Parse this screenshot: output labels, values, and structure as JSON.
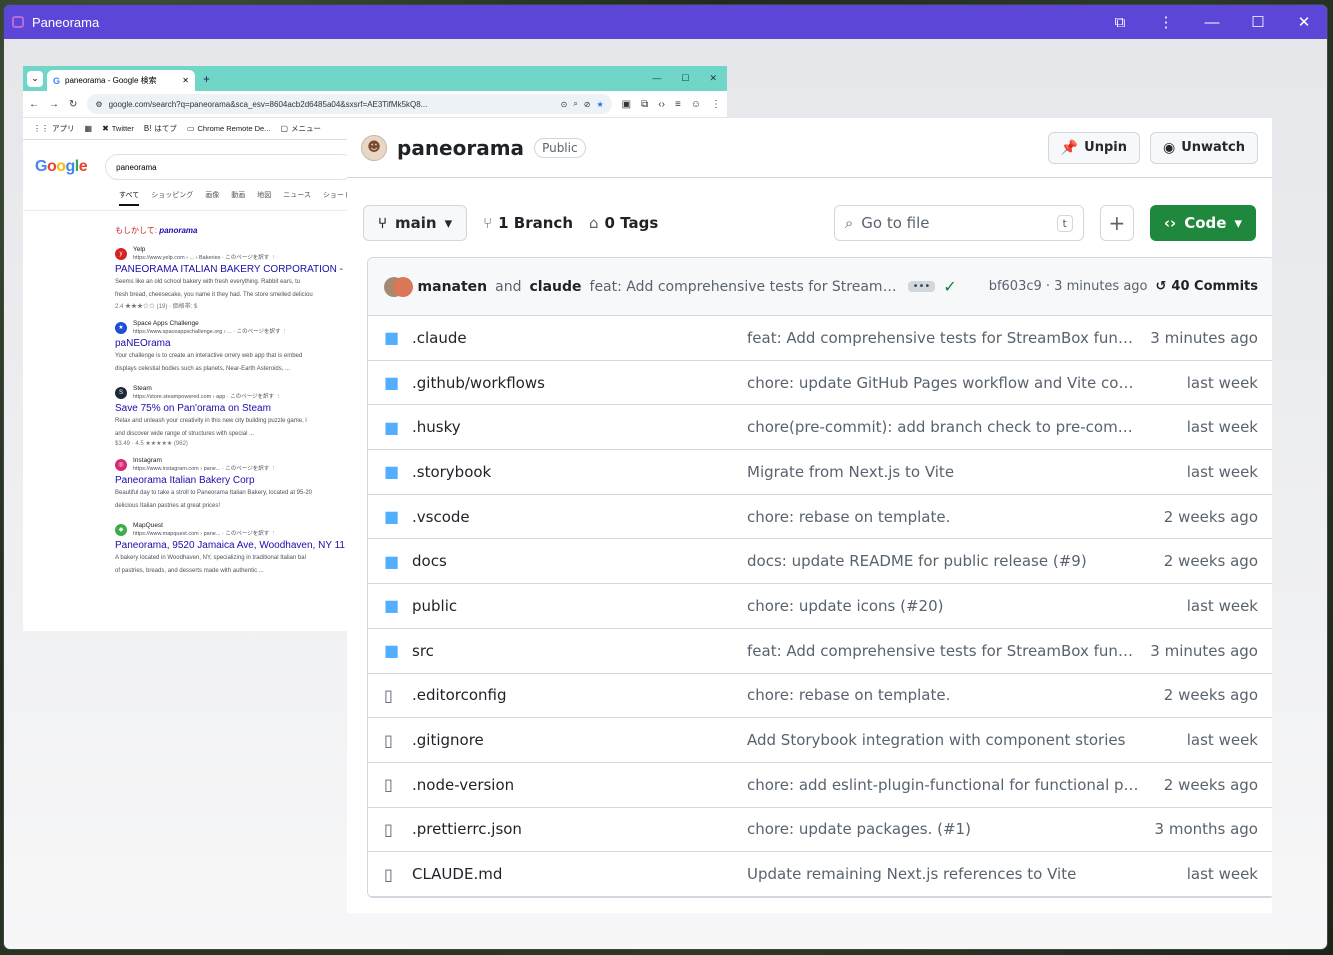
{
  "window": {
    "title": "Paneorama"
  },
  "chrome": {
    "tab_title": "paneorama - Google 検索",
    "url": "google.com/search?q=paneorama&sca_esv=8604acb2d6485a04&sxsrf=AE3TifMk5kQ8...",
    "bookmarks": [
      "アプリ",
      "Twitter",
      "はてブ",
      "Chrome Remote De...",
      "メニュー"
    ],
    "logo": "Google",
    "query": "paneorama",
    "tabs": [
      "すべて",
      "ショッピング",
      "画像",
      "動画",
      "地図",
      "ニュース",
      "ショート"
    ],
    "suggest_prefix": "もしかして:",
    "suggest_term": "panorama",
    "results": [
      {
        "source": "Yelp",
        "url": "https://www.yelp.com › ... › Bakeries · このページを訳す ⋮",
        "title": "PANEORAMA ITALIAN BAKERY CORPORATION -",
        "snippet1": "Seems like an old school bakery with fresh everything. Rabbit ears, tu",
        "snippet2": "fresh bread, cheesecake, you name it they had. The store smelled deliciou",
        "meta": "2.4 ★★★☆☆ (19) · 価格帯: $",
        "color": "#d32323",
        "glyph": "y"
      },
      {
        "source": "Space Apps Challenge",
        "url": "https://www.spaceappschallenge.org › ... · このページを訳す ⋮",
        "title": "paNEOrama",
        "snippet1": "Your challenge is to create an interactive orrery web app that is embed",
        "snippet2": "displays celestial bodies such as planets, Near-Earth Asteroids, ...",
        "meta": "",
        "color": "#1d4ed8",
        "glyph": "★"
      },
      {
        "source": "Steam",
        "url": "https://store.steampowered.com › app · このページを訳す ⋮",
        "title": "Save 75% on Pan'orama on Steam",
        "snippet1": "Relax and unleash your creativity in this new city building puzzle game, l",
        "snippet2": "and discover wide range of structures with special ...",
        "meta": "$3.49 · 4.5 ★★★★★ (962)",
        "color": "#1b2838",
        "glyph": "S"
      },
      {
        "source": "Instagram",
        "url": "https://www.instagram.com › pane... · このページを訳す ⋮",
        "title": "Paneorama Italian Bakery Corp",
        "snippet1": "Beautiful day to take a stroll to Paneorama Italian Bakery, located at 95-20",
        "snippet2": "delicious Italian pastries at great prices!",
        "meta": "",
        "color": "#d62976",
        "glyph": "◎"
      },
      {
        "source": "MapQuest",
        "url": "https://www.mapquest.com › pane... · このページを訳す ⋮",
        "title": "Paneorama, 9520 Jamaica Ave, Woodhaven, NY 11",
        "snippet1": "A bakery located in Woodhaven, NY, specializing in traditional Italian bal",
        "snippet2": "of pastries, breads, and desserts made with authentic ...",
        "meta": "",
        "color": "#3bae4a",
        "glyph": "◆"
      }
    ]
  },
  "github": {
    "repo": "paneorama",
    "visibility": "Public",
    "unpin": "Unpin",
    "unwatch": "Unwatch",
    "branch": "main",
    "branches": "1 Branch",
    "tags": "0 Tags",
    "goto": "Go to file",
    "goto_key": "t",
    "code": "Code",
    "commit": {
      "author1": "manaten",
      "and": "and",
      "author2": "claude",
      "message": "feat: Add comprehensive tests for StreamBox fun...",
      "sha": "bf603c9 · 3 minutes ago",
      "count": "40 Commits"
    },
    "files": [
      {
        "type": "folder",
        "name": ".claude",
        "msg": "feat: Add comprehensive tests for StreamBox functions...",
        "time": "3 minutes ago"
      },
      {
        "type": "folder",
        "name": ".github/workflows",
        "msg": "chore: update GitHub Pages workflow and Vite config",
        "time": "last week"
      },
      {
        "type": "folder",
        "name": ".husky",
        "msg": "chore(pre-commit): add branch check to pre-commit h...",
        "time": "last week"
      },
      {
        "type": "folder",
        "name": ".storybook",
        "msg": "Migrate from Next.js to Vite",
        "time": "last week"
      },
      {
        "type": "folder",
        "name": ".vscode",
        "msg": "chore: rebase on template.",
        "time": "2 weeks ago"
      },
      {
        "type": "folder",
        "name": "docs",
        "msg": "docs: update README for public release (#9)",
        "time": "2 weeks ago"
      },
      {
        "type": "folder",
        "name": "public",
        "msg": "chore: update icons (#20)",
        "time": "last week"
      },
      {
        "type": "folder",
        "name": "src",
        "msg": "feat: Add comprehensive tests for StreamBox functions...",
        "time": "3 minutes ago"
      },
      {
        "type": "file",
        "name": ".editorconfig",
        "msg": "chore: rebase on template.",
        "time": "2 weeks ago"
      },
      {
        "type": "file",
        "name": ".gitignore",
        "msg": "Add Storybook integration with component stories",
        "time": "last week"
      },
      {
        "type": "file",
        "name": ".node-version",
        "msg": "chore: add eslint-plugin-functional for functional progr...",
        "time": "2 weeks ago"
      },
      {
        "type": "file",
        "name": ".prettierrc.json",
        "msg": "chore: update packages. (#1)",
        "time": "3 months ago"
      },
      {
        "type": "file",
        "name": "CLAUDE.md",
        "msg": "Update remaining Next.js references to Vite",
        "time": "last week"
      }
    ]
  }
}
